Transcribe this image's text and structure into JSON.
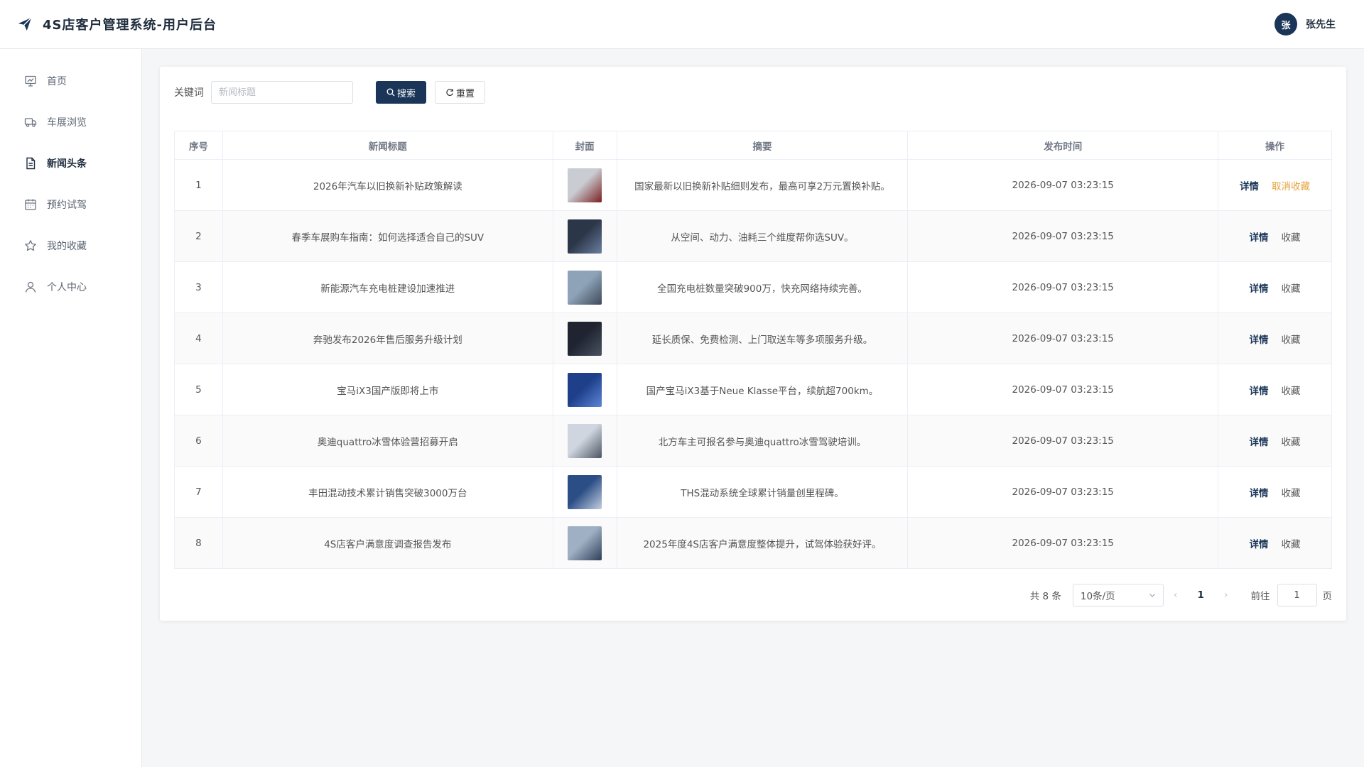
{
  "header": {
    "title": "4S店客户管理系统-用户后台",
    "user_initial": "张",
    "user_name": "张先生"
  },
  "sidebar": {
    "items": [
      {
        "label": "首页",
        "icon": "presentation-icon",
        "active": false
      },
      {
        "label": "车展浏览",
        "icon": "truck-icon",
        "active": false
      },
      {
        "label": "新闻头条",
        "icon": "document-icon",
        "active": true
      },
      {
        "label": "预约试驾",
        "icon": "calendar-icon",
        "active": false
      },
      {
        "label": "我的收藏",
        "icon": "star-icon",
        "active": false
      },
      {
        "label": "个人中心",
        "icon": "user-icon",
        "active": false
      }
    ]
  },
  "search": {
    "label": "关键词",
    "placeholder": "新闻标题",
    "value": "",
    "search_button": "搜索",
    "reset_button": "重置"
  },
  "table": {
    "columns": [
      "序号",
      "新闻标题",
      "封面",
      "摘要",
      "发布时间",
      "操作"
    ],
    "rows": [
      {
        "index": "1",
        "title": "2026年汽车以旧换新补贴政策解读",
        "summary": "国家最新以旧换新补贴细则发布，最高可享2万元置换补贴。",
        "time": "2026-09-07 03:23:15",
        "detail": "详情",
        "fav": "取消收藏",
        "fav_active": true
      },
      {
        "index": "2",
        "title": "春季车展购车指南：如何选择适合自己的SUV",
        "summary": "从空间、动力、油耗三个维度帮你选SUV。",
        "time": "2026-09-07 03:23:15",
        "detail": "详情",
        "fav": "收藏",
        "fav_active": false
      },
      {
        "index": "3",
        "title": "新能源汽车充电桩建设加速推进",
        "summary": "全国充电桩数量突破900万，快充网络持续完善。",
        "time": "2026-09-07 03:23:15",
        "detail": "详情",
        "fav": "收藏",
        "fav_active": false
      },
      {
        "index": "4",
        "title": "奔驰发布2026年售后服务升级计划",
        "summary": "延长质保、免费检测、上门取送车等多项服务升级。",
        "time": "2026-09-07 03:23:15",
        "detail": "详情",
        "fav": "收藏",
        "fav_active": false
      },
      {
        "index": "5",
        "title": "宝马iX3国产版即将上市",
        "summary": "国产宝马iX3基于Neue Klasse平台，续航超700km。",
        "time": "2026-09-07 03:23:15",
        "detail": "详情",
        "fav": "收藏",
        "fav_active": false
      },
      {
        "index": "6",
        "title": "奥迪quattro冰雪体验营招募开启",
        "summary": "北方车主可报名参与奥迪quattro冰雪驾驶培训。",
        "time": "2026-09-07 03:23:15",
        "detail": "详情",
        "fav": "收藏",
        "fav_active": false
      },
      {
        "index": "7",
        "title": "丰田混动技术累计销售突破3000万台",
        "summary": "THS混动系统全球累计销量创里程碑。",
        "time": "2026-09-07 03:23:15",
        "detail": "详情",
        "fav": "收藏",
        "fav_active": false
      },
      {
        "index": "8",
        "title": "4S店客户满意度调查报告发布",
        "summary": "2025年度4S店客户满意度整体提升，试驾体验获好评。",
        "time": "2026-09-07 03:23:15",
        "detail": "详情",
        "fav": "收藏",
        "fav_active": false
      }
    ]
  },
  "pagination": {
    "total": "共 8 条",
    "page_size": "10条/页",
    "current_page": "1",
    "goto_label": "前往",
    "goto_value": "1",
    "goto_suffix": "页"
  },
  "colors": {
    "primary": "#1a3558",
    "warning": "#e6a23c"
  }
}
